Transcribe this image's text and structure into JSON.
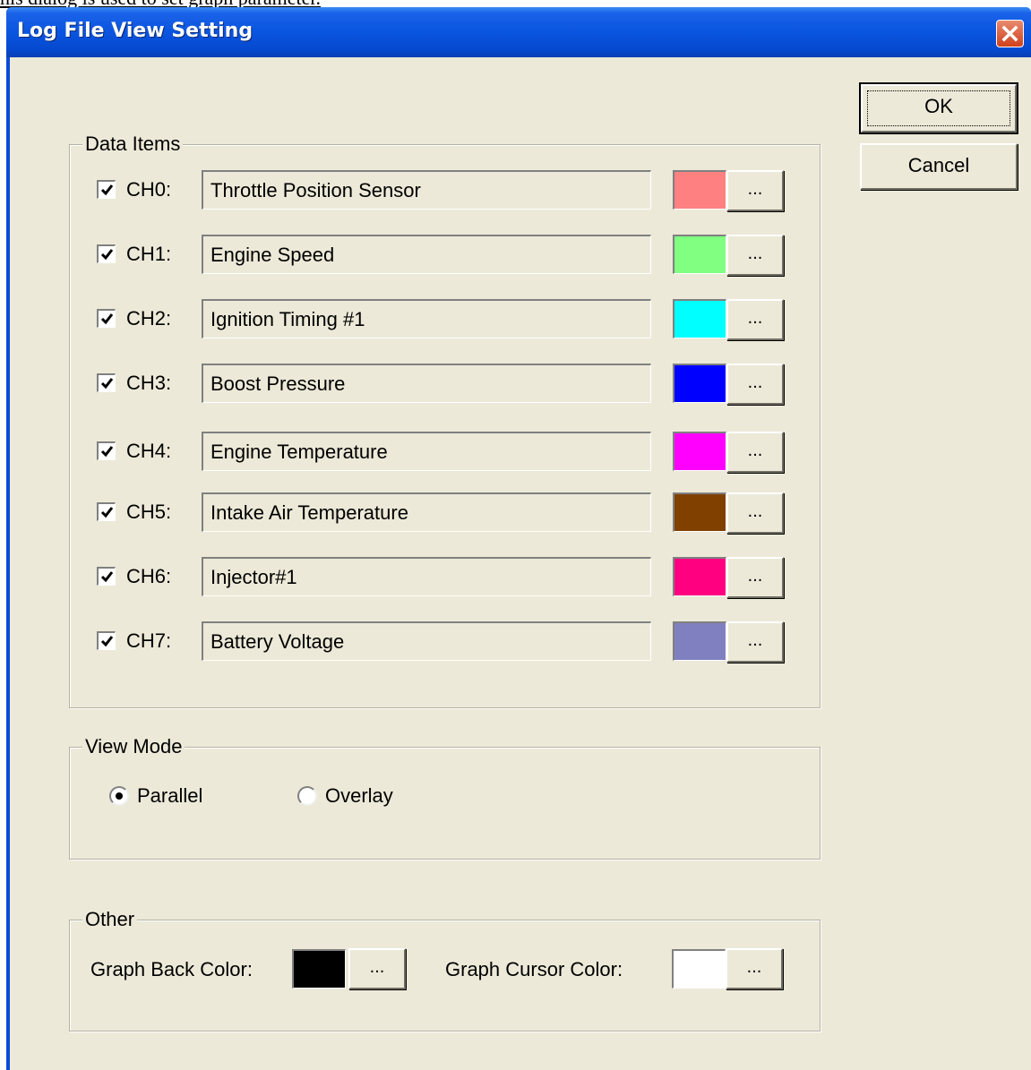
{
  "caption": "his dialog is used to set graph parameter.",
  "window": {
    "title": "Log File View Setting",
    "close_icon": "close-icon"
  },
  "buttons": {
    "ok": "OK",
    "cancel": "Cancel"
  },
  "data_items": {
    "legend": "Data Items",
    "channels": [
      {
        "label": "CH0:",
        "name": "Throttle Position Sensor",
        "checked": true,
        "color": "#ff8080",
        "button": "..."
      },
      {
        "label": "CH1:",
        "name": "Engine Speed",
        "checked": true,
        "color": "#80ff80",
        "button": "..."
      },
      {
        "label": "CH2:",
        "name": "Ignition Timing #1",
        "checked": true,
        "color": "#00ffff",
        "button": "..."
      },
      {
        "label": "CH3:",
        "name": "Boost Pressure",
        "checked": true,
        "color": "#0000ff",
        "button": "..."
      },
      {
        "label": "CH4:",
        "name": "Engine Temperature",
        "checked": true,
        "color": "#ff00ff",
        "button": "..."
      },
      {
        "label": "CH5:",
        "name": "Intake Air Temperature",
        "checked": true,
        "color": "#804000",
        "button": "..."
      },
      {
        "label": "CH6:",
        "name": "Injector#1",
        "checked": true,
        "color": "#ff0080",
        "button": "..."
      },
      {
        "label": "CH7:",
        "name": "Battery Voltage",
        "checked": true,
        "color": "#8080c0",
        "button": "..."
      }
    ]
  },
  "view_mode": {
    "legend": "View Mode",
    "options": [
      {
        "label": "Parallel",
        "selected": true
      },
      {
        "label": "Overlay",
        "selected": false
      }
    ]
  },
  "other": {
    "legend": "Other",
    "back_color_label": "Graph Back Color:",
    "back_color": "#000000",
    "back_button": "...",
    "cursor_color_label": "Graph Cursor Color:",
    "cursor_color": "#ffffff",
    "cursor_button": "..."
  }
}
